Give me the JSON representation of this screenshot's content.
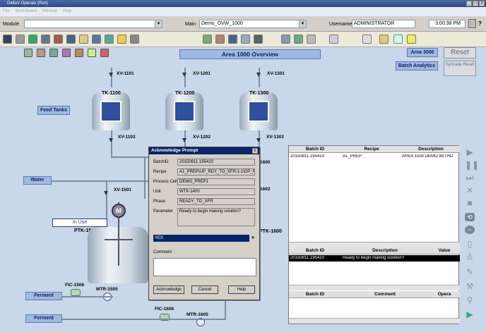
{
  "window": {
    "title": "DeltaV Operate (Run)",
    "min": "_",
    "max": "□",
    "close": "X"
  },
  "menu": [
    "File",
    "WorkSpace",
    "Window",
    "Help"
  ],
  "toolbar": {
    "module_label": "Module",
    "module_value": "",
    "main_label": "Main",
    "main_value": "Demo_OVW_1000",
    "username_label": "Username",
    "username_value": "ADMINISTRATOR",
    "time": "3:00:38 PM",
    "help": "?"
  },
  "overview": {
    "title": "Area 1000 Overview",
    "area_button": "Area 3000",
    "reset_button": "Reset",
    "batch_analytics": "Batch Analytics",
    "syncade_reset": "Syncade Reset",
    "feed_tanks": "Feed Tanks",
    "water": "Water",
    "in_use": "In Use",
    "ferment1": "Ferment",
    "ferment2": "Ferment"
  },
  "tanks": [
    {
      "name": "TK-1100",
      "color": "#2f4f9f"
    },
    {
      "name": "TK-1200",
      "color": "#2f4f9f"
    },
    {
      "name": "TK-1300",
      "color": "#2f4f9f"
    }
  ],
  "labels": {
    "xv1101": "XV-1101",
    "xv1201": "XV-1201",
    "xv1301": "XV-1301",
    "xv1102": "XV-1102",
    "xv1202": "XV-1202",
    "xv1302": "XV-1302",
    "xv1501": "XV-1501",
    "ptk1500": "PTK-1500",
    "ptk1600": "PTK-1600",
    "fic1506": "FIC-1506",
    "mtr1505": "MTR-1505",
    "fic1606": "FIC-1606",
    "mtr1605": "MTR-1605",
    "v1600a": "1600",
    "v1602": "1602",
    "motor": "M"
  },
  "dialog": {
    "title": "Acknowledge Prompt",
    "close": "x",
    "rows": [
      {
        "label": "BatchID",
        "value": "20150911.195410"
      },
      {
        "label": "Recipe",
        "value": "A1_PREP\\UP_RDY_TO_XFR:1-1\\DP_RD"
      },
      {
        "label": "Process Cell",
        "value": "DEMO_PREP1"
      },
      {
        "label": "Unit",
        "value": "WTK-1400"
      },
      {
        "label": "Phase",
        "value": "READY_TO_XFR"
      }
    ],
    "parameter_label": "Parameter",
    "parameter_value": "Ready to begin making solution?",
    "select_value": "YES",
    "comment_label": "Comment",
    "comment_value": "",
    "ack_button": "Acknowledge",
    "cancel_button": "Cancel",
    "help_button": "Help"
  },
  "batch_list": {
    "headers": [
      "Batch ID",
      "Recipe",
      "Description"
    ],
    "rows": [
      {
        "batch_id": "20150911.195410",
        "recipe": "A1_PREP",
        "description": "AREA 1000 DEMO WITHO"
      }
    ]
  },
  "prompt_list": {
    "headers": [
      "Batch ID",
      "Description",
      "Value"
    ],
    "rows": [
      {
        "batch_id": "20150911.195410",
        "description": "Ready to begin making solution?",
        "value": ""
      }
    ]
  },
  "comment_list": {
    "headers": [
      "Batch ID",
      "Comment",
      "Opera"
    ]
  }
}
